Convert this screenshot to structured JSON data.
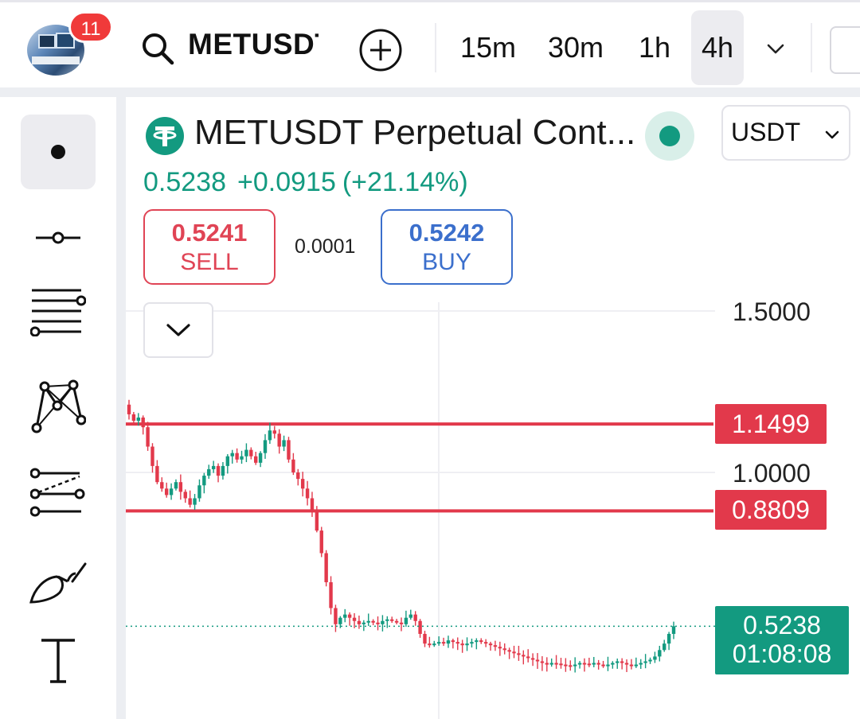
{
  "topbar": {
    "notification_count": "11",
    "symbol": "METUSDT",
    "timeframes": [
      "15m",
      "30m",
      "1h",
      "4h"
    ],
    "active_timeframe": "4h"
  },
  "toolbar": {
    "tools": [
      "cursor-dot-icon",
      "horizontal-line-icon",
      "fib-retracement-icon",
      "pattern-icon",
      "parallel-channel-icon",
      "brush-icon",
      "text-icon"
    ],
    "active_tool": "cursor-dot-icon"
  },
  "instrument": {
    "title": "METUSDT Perpetual Contract",
    "title_display": "METUSDT Perpetual Cont...",
    "quote_currency": "USDT",
    "last_price": "0.5238",
    "change": "+0.0915",
    "change_pct": "(+21.14%)",
    "status": "online"
  },
  "order": {
    "sell_price": "0.5241",
    "sell_label": "SELL",
    "buy_price": "0.5242",
    "buy_label": "BUY",
    "spread": "0.0001"
  },
  "price_axis": {
    "levels": [
      "1.5000",
      "1.0000"
    ]
  },
  "price_lines": [
    {
      "label": "1.1499",
      "value": 1.1499,
      "color": "#e2394b"
    },
    {
      "label": "0.8809",
      "value": 0.8809,
      "color": "#e2394b"
    }
  ],
  "last_price_tag": {
    "price": "0.5238",
    "countdown": "01:08:08",
    "color": "#139a80"
  },
  "colors": {
    "up": "#139a80",
    "down": "#e2394b",
    "buy": "#3b6fcc"
  },
  "chart_data": {
    "type": "candlestick",
    "y_scale": [
      0.45,
      1.62
    ],
    "close_path": [
      1.18,
      1.16,
      1.17,
      1.14,
      1.08,
      1.02,
      0.97,
      0.95,
      0.93,
      0.95,
      0.97,
      0.94,
      0.92,
      0.9,
      0.92,
      0.96,
      0.99,
      1.01,
      1.02,
      0.99,
      1.02,
      1.05,
      1.06,
      1.04,
      1.05,
      1.07,
      1.05,
      1.03,
      1.06,
      1.1,
      1.13,
      1.12,
      1.08,
      1.1,
      1.04,
      1.0,
      0.98,
      0.95,
      0.92,
      0.88,
      0.82,
      0.75,
      0.66,
      0.58,
      0.53,
      0.55,
      0.56,
      0.55,
      0.54,
      0.53,
      0.535,
      0.54,
      0.535,
      0.53,
      0.54,
      0.545,
      0.54,
      0.535,
      0.53,
      0.55,
      0.56,
      0.54,
      0.5,
      0.47,
      0.465,
      0.47,
      0.475,
      0.47,
      0.48,
      0.475,
      0.47,
      0.465,
      0.47,
      0.475,
      0.48,
      0.475,
      0.47,
      0.465,
      0.46,
      0.455,
      0.45,
      0.445,
      0.44,
      0.435,
      0.43,
      0.425,
      0.42,
      0.415,
      0.41,
      0.405,
      0.41,
      0.408,
      0.405,
      0.403,
      0.4,
      0.405,
      0.41,
      0.408,
      0.405,
      0.41,
      0.405,
      0.4,
      0.405,
      0.41,
      0.415,
      0.41,
      0.405,
      0.403,
      0.405,
      0.41,
      0.415,
      0.42,
      0.43,
      0.45,
      0.47,
      0.5,
      0.5238
    ]
  }
}
